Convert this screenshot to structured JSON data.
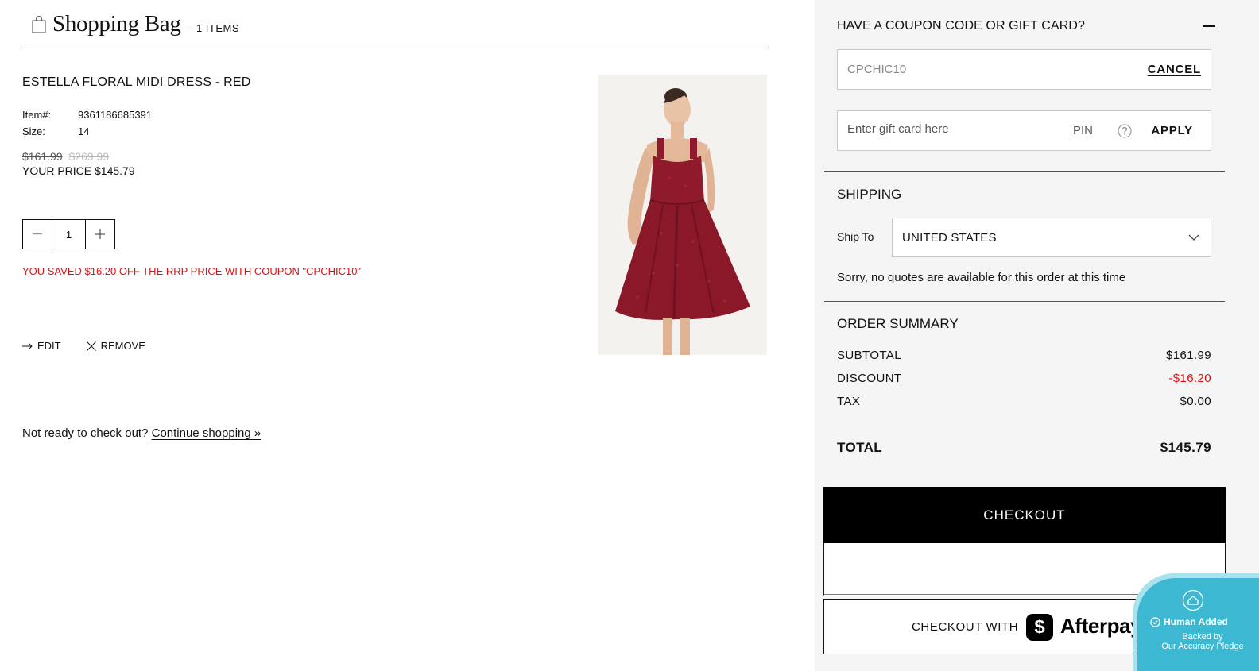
{
  "bag": {
    "title": "Shopping Bag",
    "count": "- 1 ITEMS",
    "item": {
      "name": "ESTELLA FLORAL MIDI DRESS - RED",
      "item_label": "Item#:",
      "item_number": "9361186685391",
      "size_label": "Size:",
      "size": "14",
      "price": "$161.99",
      "original_price": "$269.99",
      "your_price": "YOUR PRICE $145.79",
      "quantity": "1",
      "savings_message": "YOU SAVED $16.20 OFF THE RRP PRICE WITH COUPON \"CPCHIC10\"",
      "edit_label": "EDIT",
      "remove_label": "REMOVE"
    },
    "not_ready_text": "Not ready to check out?",
    "continue_link": "Continue shopping »"
  },
  "coupon": {
    "title": "HAVE A COUPON CODE OR GIFT CARD?",
    "code_value": "CPCHIC10",
    "cancel_label": "CANCEL",
    "gift_placeholder": "Enter gift card here",
    "pin_label": "PIN",
    "apply_label": "APPLY"
  },
  "shipping": {
    "title": "SHIPPING",
    "ship_to_label": "Ship To",
    "country": "UNITED STATES",
    "message": "Sorry, no quotes are available for this order at this time"
  },
  "summary": {
    "title": "ORDER SUMMARY",
    "subtotal_label": "SUBTOTAL",
    "subtotal": "$161.99",
    "discount_label": "DISCOUNT",
    "discount": "-$16.20",
    "tax_label": "TAX",
    "tax": "$0.00",
    "total_label": "TOTAL",
    "total": "$145.79"
  },
  "checkout": {
    "button_label": "CHECKOUT",
    "afterpay_label": "CHECKOUT WITH",
    "afterpay_brand": "Afterpay",
    "afterpay_glyph": "$"
  },
  "badge": {
    "main": "Human Added",
    "sub_line1": "Backed by",
    "sub_line2": "Our Accuracy Pledge"
  },
  "colors": {
    "accent_red": "#e01010",
    "sidebar_bg": "#f5f5f5",
    "checkout_bg": "#000000",
    "badge_bg": "#3db8d2",
    "dress_red": "#8e1a2c"
  },
  "icons": {
    "bag": "shopping-bag-icon",
    "edit": "arrow-right-icon",
    "remove": "close-icon",
    "help": "question-circle-icon",
    "select": "chevron-down-icon",
    "collapse": "minus-icon",
    "badge": "home-icon",
    "check": "check-circle-icon"
  }
}
